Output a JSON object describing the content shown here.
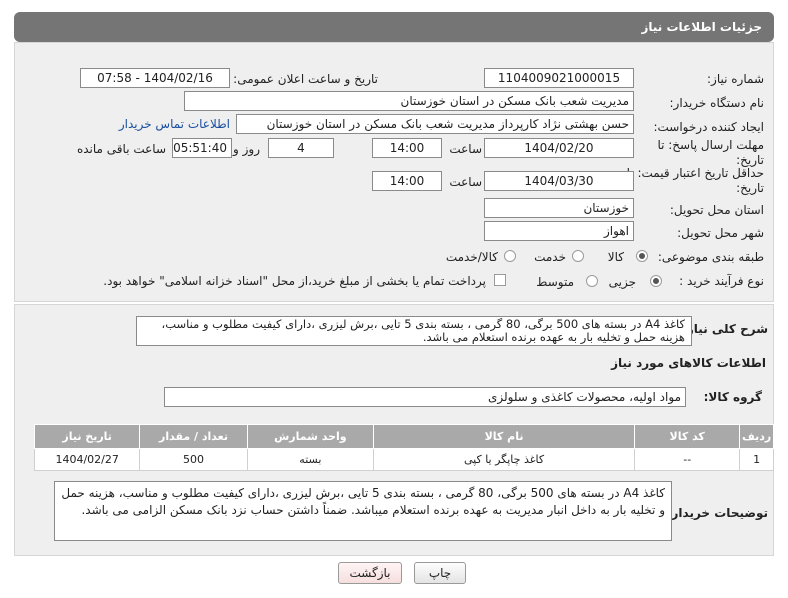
{
  "header": {
    "title": "جزئیات اطلاعات نیاز"
  },
  "fields": {
    "need_number_label": "شماره نیاز:",
    "need_number": "1104009021000015",
    "announce_label": "تاریخ و ساعت اعلان عمومی:",
    "announce_value": "1404/02/16 - 07:58",
    "buyer_org_label": "نام دستگاه خریدار:",
    "buyer_org": "مدیریت شعب بانک مسکن در استان خوزستان",
    "creator_label": "ایجاد کننده درخواست:",
    "creator": "حسن بهشتی نژاد کارپرداز مدیریت شعب بانک مسکن در استان خوزستان",
    "contact_link": "اطلاعات تماس خریدار",
    "deadline_label": "مهلت ارسال پاسخ: تا تاریخ:",
    "deadline_date": "1404/02/20",
    "time_label": "ساعت",
    "deadline_time": "14:00",
    "days_value": "4",
    "days_label": "روز و",
    "remaining_time": "05:51:40",
    "remaining_label": "ساعت باقی مانده",
    "validity_label": "حداقل تاریخ اعتبار قیمت: تا تاریخ:",
    "validity_date": "1404/03/30",
    "validity_time": "14:00",
    "province_label": "استان محل تحویل:",
    "province": "خوزستان",
    "city_label": "شهر محل تحویل:",
    "city": "اهواز",
    "category_label": "طبقه بندی موضوعی:",
    "category_options": [
      "کالا",
      "خدمت",
      "کالا/خدمت"
    ],
    "process_label": "نوع فرآیند خرید :",
    "process_options": [
      "جزیی",
      "متوسط"
    ],
    "payment_note": "پرداخت تمام یا بخشی از مبلغ خرید،از محل \"اسناد خزانه اسلامی\" خواهد بود."
  },
  "description": {
    "label": "شرح کلی نیاز:",
    "text": "کاغذ A4 در بسته های 500 برگی، 80 گرمی ، بسته بندی 5 تایی ،برش لیزری ،دارای کیفیت مطلوب و مناسب، هزینه حمل و تخلیه بار به عهده برنده استعلام می باشد."
  },
  "goods": {
    "section_title": "اطلاعات کالاهای مورد نیاز",
    "group_label": "گروه کالا:",
    "group_value": "مواد اولیه، محصولات کاغذی و سلولزی",
    "columns": [
      "ردیف",
      "کد کالا",
      "نام کالا",
      "واحد شمارش",
      "تعداد / مقدار",
      "تاریخ نیاز"
    ],
    "rows": [
      {
        "row": "1",
        "code": "--",
        "name": "کاغذ چاپگر یا کپی",
        "unit": "بسته",
        "qty": "500",
        "date": "1404/02/27"
      }
    ]
  },
  "buyer_notes": {
    "label": "توضیحات خریدار:",
    "text": "کاغذ A4 در بسته های 500 برگی، 80 گرمی ، بسته بندی 5 تایی ،برش لیزری ،دارای کیفیت مطلوب و مناسب، هزینه حمل و تخلیه بار به داخل انبار مدیریت به عهده برنده استعلام میباشد. ضمناً داشتن حساب نزد بانک مسکن الزامی می باشد."
  },
  "buttons": {
    "print": "چاپ",
    "back": "بازگشت"
  },
  "colors": {
    "header_bg": "#757575",
    "panel_bg": "#efefef",
    "table_header": "#a9a9a9"
  }
}
